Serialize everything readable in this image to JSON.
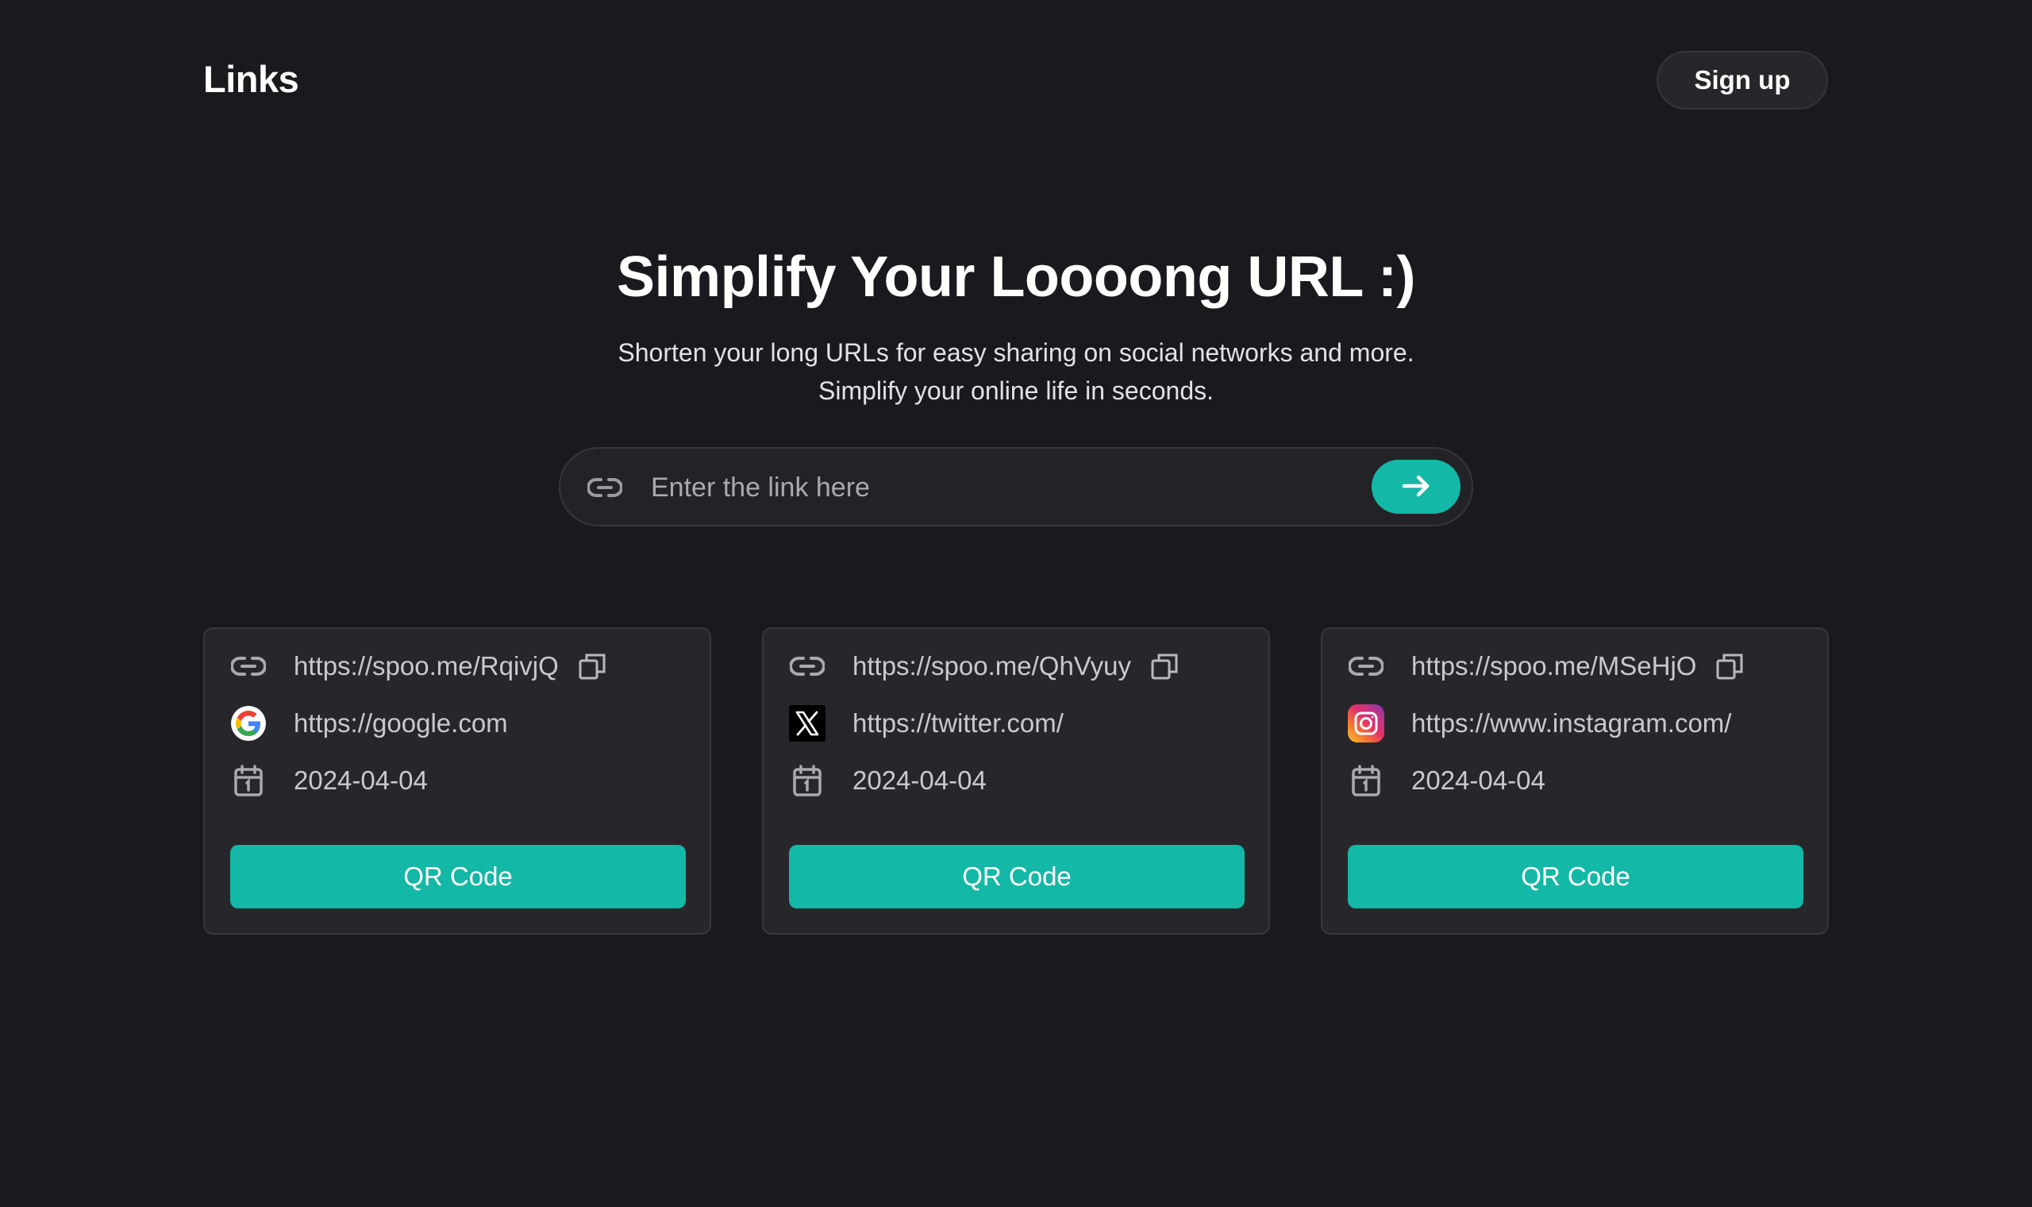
{
  "header": {
    "brand": "Links",
    "signup_label": "Sign up"
  },
  "hero": {
    "title": "Simplify Your Loooong URL :)",
    "subtitle_line1": "Shorten your long URLs for easy sharing on social networks and more.",
    "subtitle_line2": "Simplify your online life in seconds."
  },
  "search": {
    "placeholder": "Enter the link here",
    "value": ""
  },
  "colors": {
    "background": "#1a1a1e",
    "card": "#27272b",
    "accent": "#14b8a6"
  },
  "cards": [
    {
      "short_url": "https://spoo.me/RqivjQ",
      "original_url": "https://google.com",
      "site_icon": "google-icon",
      "date": "2024-04-04",
      "button_label": "QR Code"
    },
    {
      "short_url": "https://spoo.me/QhVyuy",
      "original_url": "https://twitter.com/",
      "site_icon": "x-twitter-icon",
      "date": "2024-04-04",
      "button_label": "QR Code"
    },
    {
      "short_url": "https://spoo.me/MSeHjO",
      "original_url": "https://www.instagram.com/",
      "site_icon": "instagram-icon",
      "date": "2024-04-04",
      "button_label": "QR Code"
    }
  ]
}
